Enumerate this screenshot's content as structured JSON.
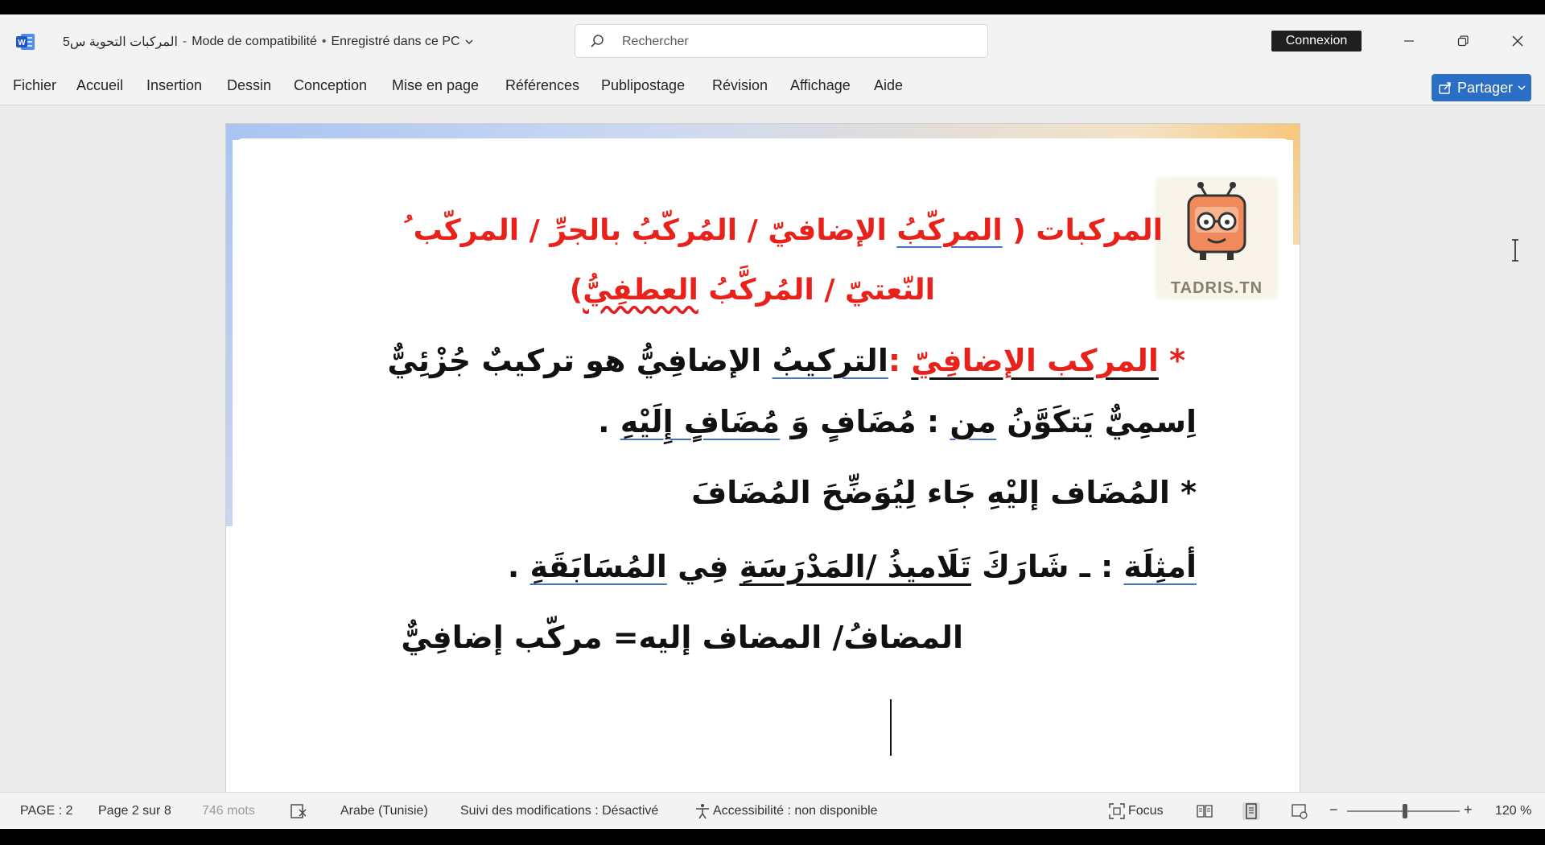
{
  "titlebar": {
    "doc_name": "المركبات التحوية س5",
    "mode": "Mode de compatibilité",
    "bullet": "•",
    "dash": "-",
    "save_status": "Enregistré dans ce PC",
    "search_placeholder": "Rechercher",
    "signin_label": "Connexion"
  },
  "ribbon": {
    "tabs": [
      "Fichier",
      "Accueil",
      "Insertion",
      "Dessin",
      "Conception",
      "Mise en page",
      "Références",
      "Publipostage",
      "Révision",
      "Affichage",
      "Aide"
    ],
    "share_label": "Partager"
  },
  "document": {
    "logo_text": "TADRIS.TN",
    "heading_line1_a": "المركبات ( ",
    "heading_line1_b": "المركّبُ",
    "heading_line1_c": " الإضافيّ / المُركّبُ بالجرِّ / المركّب ُ",
    "heading_line2_a": "النّعتيّ / المُركَّبُ ",
    "heading_line2_b": "العطفِيُّ",
    "heading_line2_c": ")",
    "p1_star": "* ",
    "p1_term": "المركب الإضافِيّ",
    "p1_colon": " :",
    "p1_def_a": "التركيبُ",
    "p1_def_b": " الإضافِيُّ هو تركيبٌ جُزْئِيٌّ",
    "p1_line2_a": "اِسمِيٌّ يَتكَوَّنُ ",
    "p1_line2_b": "من",
    "p1_line2_c": " : مُضَافٍ وَ ",
    "p1_line2_d": "مُضَافٍ إِلَيْهِ",
    "p1_line2_e": " .",
    "p2": "* المُضَاف إليْهِ جَاء لِيُوَضِّحَ المُضَافَ",
    "p3_a": "أمثِلَة",
    "p3_b": " : ـ شَارَكَ ",
    "p3_c": "تَلَاميذُ /المَدْرَسَةِ",
    "p3_d": " فِي ",
    "p3_e": "المُسَابَقَةِ",
    "p3_f": " .",
    "p4": "المضافُ/ المضاف إليه= مركّب إضافِيٌّ"
  },
  "statusbar": {
    "page_label": "PAGE : 2",
    "page_of": "Page 2 sur 8",
    "words": "746 mots",
    "language": "Arabe (Tunisie)",
    "track_changes": "Suivi des modifications : Désactivé",
    "accessibility": "Accessibilité : non disponible",
    "focus_label": "Focus",
    "zoom_minus": "−",
    "zoom_plus": "+",
    "zoom_level": "120 %"
  },
  "colors": {
    "accent": "#2b6ec5",
    "heading_red": "#e8221b",
    "underline_blue": "#4a70c4"
  },
  "icons": [
    "word-logo-icon",
    "search-icon",
    "minimize-icon",
    "restore-icon",
    "close-icon",
    "share-icon",
    "chevron-down-icon",
    "proofing-icon",
    "accessibility-icon",
    "focus-icon",
    "read-mode-icon",
    "print-layout-icon",
    "web-layout-icon",
    "text-cursor-icon"
  ]
}
